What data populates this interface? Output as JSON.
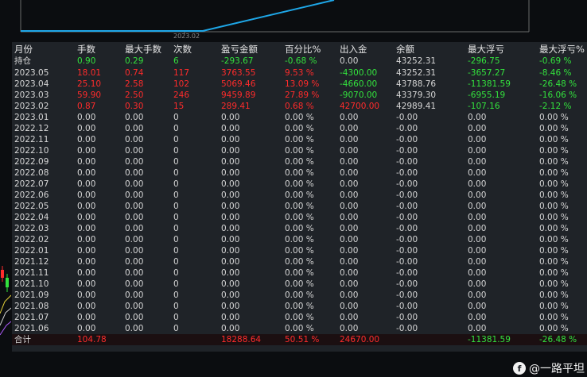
{
  "chart": {
    "date_label": "2023.02"
  },
  "columns": [
    "月份",
    "手数",
    "最大手数",
    "次数",
    "盈亏金额",
    "百分比%",
    "出入金",
    "余额",
    "最大浮亏",
    "最大浮亏%"
  ],
  "position_row": [
    "持仓",
    "0.90",
    "0.29",
    "6",
    "-293.67",
    "-0.68 %",
    "0.00",
    "43252.31",
    "-296.75",
    "-0.69 %"
  ],
  "data_rows": [
    [
      "2023.05",
      "18.01",
      "0.74",
      "117",
      "3763.55",
      "9.53 %",
      "-4300.00",
      "43252.31",
      "-3657.27",
      "-8.46 %"
    ],
    [
      "2023.04",
      "25.10",
      "2.58",
      "102",
      "5069.46",
      "13.09 %",
      "-4660.00",
      "43788.76",
      "-11381.59",
      "-26.48 %"
    ],
    [
      "2023.03",
      "59.90",
      "2.50",
      "246",
      "9459.89",
      "27.89 %",
      "-9070.00",
      "43379.30",
      "-6955.19",
      "-16.06 %"
    ],
    [
      "2023.02",
      "0.87",
      "0.30",
      "15",
      "289.41",
      "0.68 %",
      "42700.00",
      "42989.41",
      "-107.16",
      "-2.12 %"
    ]
  ],
  "zero_months": [
    "2023.01",
    "2022.12",
    "2022.11",
    "2022.10",
    "2022.09",
    "2022.08",
    "2022.07",
    "2022.06",
    "2022.05",
    "2022.04",
    "2022.03",
    "2022.02",
    "2022.01",
    "2021.12",
    "2021.11",
    "2021.10",
    "2021.09",
    "2021.08",
    "2021.07",
    "2021.06"
  ],
  "zero_values": [
    "0.00",
    "0.00",
    "0",
    "0.00",
    "0.00 %",
    "0.00",
    "-0.00",
    "0.00",
    "0.00 %"
  ],
  "total_row": [
    "合计",
    "104.78",
    "",
    "",
    "18288.64",
    "50.51 %",
    "24670.00",
    "",
    "-11381.59",
    "-26.48 %"
  ],
  "watermark": {
    "logo": "f",
    "text": "@一路平坦"
  },
  "colors": {
    "positive": "#33e23d",
    "negative": "#ff2b2b",
    "neutral": "#d6d6d6",
    "line": "#1ea7e8"
  }
}
